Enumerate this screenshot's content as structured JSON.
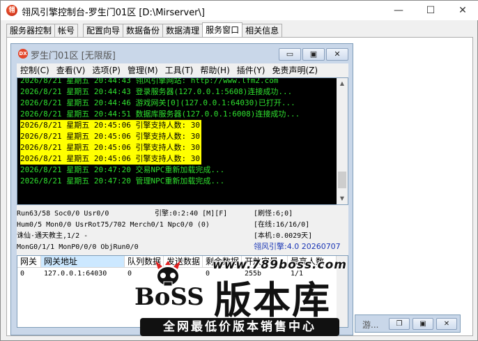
{
  "window": {
    "title": "翎风引擎控制台-罗生门01区 [D:\\Mirserver\\]",
    "minimize": "—",
    "maximize": "☐",
    "close": "✕"
  },
  "tabs": [
    {
      "label": "服务器控制"
    },
    {
      "label": "帐号"
    },
    {
      "label": "配置向导"
    },
    {
      "label": "数据备份"
    },
    {
      "label": "数据清理"
    },
    {
      "label": "服务窗口"
    },
    {
      "label": "相关信息"
    }
  ],
  "child": {
    "icon_text": "DX",
    "title": "罗生门01区 [无限版]",
    "btn_min": "▭",
    "btn_max": "▣",
    "btn_close": "✕"
  },
  "menu": [
    "控制(C)",
    "查看(V)",
    "选项(P)",
    "管理(M)",
    "工具(T)",
    "帮助(H)",
    "插件(Y)",
    "免责声明(Z)"
  ],
  "log": [
    {
      "text": "2026/8/21 星期五 20:44:43 翎风引擎网站: http://www.lfm2.com",
      "hl": false
    },
    {
      "text": "2026/8/21 星期五 20:44:43 登录服务器(127.0.0.1:5608)连接成功...",
      "hl": false
    },
    {
      "text": "2026/8/21 星期五 20:44:46 游戏网关[0](127.0.0.1:64030)已打开...",
      "hl": false
    },
    {
      "text": "2026/8/21 星期五 20:44:51 数据库服务器(127.0.0.1:6008)连接成功...",
      "hl": false
    },
    {
      "text": "2026/8/21 星期五 20:45:06 引擎支持人数: 30",
      "hl": true
    },
    {
      "text": "2026/8/21 星期五 20:45:06 引擎支持人数: 30",
      "hl": true
    },
    {
      "text": "2026/8/21 星期五 20:45:06 引擎支持人数: 30",
      "hl": true
    },
    {
      "text": "2026/8/21 星期五 20:45:06 引擎支持人数: 30",
      "hl": true
    },
    {
      "text": "2026/8/21 星期五 20:47:20 交易NPC重新加载完成...",
      "hl": false
    },
    {
      "text": "2026/8/21 星期五 20:47:20 管理NPC重新加载完成...",
      "hl": false
    }
  ],
  "status": {
    "run": "Run63/58 Soc0/0 Usr0/0",
    "engine": "引擎:0:2:40 [M][F]",
    "refresh": "[刷怪:6;0]",
    "hum": "Hum0/5 Mon0/0 UsrRot75/702 Merch0/1 Npc0/0 (0)",
    "online": "[在线:16/16/0]",
    "map": "诛仙·通天教主,1/2 -",
    "local": "[本机:0.0029天]",
    "mongo": "MonG0/1/1 MonP0/0/0 ObjRun0/0",
    "version": "翎风引擎:4.0 20260707"
  },
  "grid": {
    "headers": [
      "网关",
      "网关地址",
      "队列数据",
      "发送数据",
      "剩余数据",
      "开放容量",
      "最高人数"
    ],
    "row": [
      "0",
      "127.0.0.1:64030",
      "0",
      "",
      "0",
      "255b",
      "1/1"
    ]
  },
  "watermark": {
    "url": "www.789boss.com",
    "boss": "BoSS",
    "main": "版本库",
    "bar": "全网最低价版本销售中心"
  },
  "bottom_strip": {
    "text": "游..."
  }
}
